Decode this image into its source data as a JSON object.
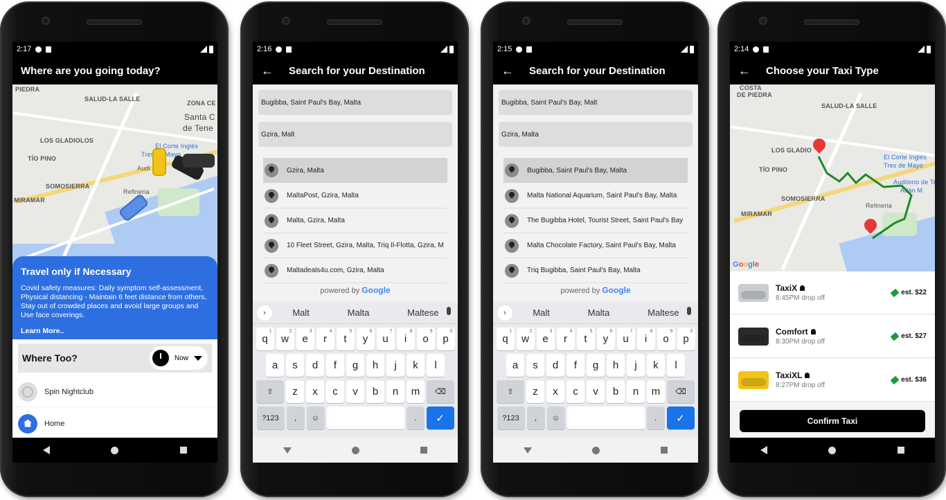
{
  "screen1": {
    "status_time": "2:17",
    "title": "Where are you going today?",
    "map_labels": [
      "PIEDRA",
      "SALUD-LA SALLE",
      "ZONA CE",
      "Santa C",
      "de Tene",
      "LOS GLADIOLOS",
      "TÍO PINO",
      "El Corte Inglés",
      "Tres de Mayo",
      "Audi",
      "SOMOSIERRA",
      "Refineria",
      "MIRAMAR"
    ],
    "google": "Google",
    "covid_title": "Travel only if Necessary",
    "covid_text": "Covid safety measures: Daily symptom self-assessment, Physical distancing - Maintain 6 feet distance from others, Stay out of crowded places and avoid large groups and Use face coverings.",
    "learn_more": "Learn More..",
    "where_label": "Where Too?",
    "when_value": "Now",
    "places": [
      {
        "label": "Spin Nightclub",
        "icon": "clock-icon"
      },
      {
        "label": "Home",
        "icon": "home-icon"
      }
    ]
  },
  "screen2": {
    "status_time": "2:16",
    "title": "Search for your Destination",
    "origin": "Bugibba, Saint Paul's Bay, Malta",
    "destination": "Gzira, Malt",
    "suggestions": [
      "Gzira, Malta",
      "MaltaPost, Gzira, Malta",
      "Malta, Gzira, Malta",
      "10 Fleet Street, Gzira, Malta, Triq Il-Flotta, Gzira, M",
      "Maltadeals4u.com, Gzira, Malta"
    ],
    "powered_by": "powered by",
    "google": "Google",
    "kb_suggestions": [
      "Malt",
      "Malta",
      "Maltese"
    ]
  },
  "screen3": {
    "status_time": "2:15",
    "title": "Search for your Destination",
    "origin": "Bugibba, Saint Paul's Bay, Malt",
    "destination": "Gzira, Malta",
    "suggestions": [
      "Bugibba, Saint Paul's Bay, Malta",
      "Malta National Aquarium, Saint Paul's Bay, Malta",
      "The Bugibba Hotel, Tourist Street, Saint Paul's Bay",
      "Malta Chocolate Factory, Saint Paul's Bay, Malta",
      "Triq Bugibba, Saint Paul's Bay, Malta"
    ],
    "powered_by": "powered by",
    "google": "Google",
    "kb_suggestions": [
      "Malt",
      "Malta",
      "Maltese"
    ]
  },
  "keyboard": {
    "row1": [
      "q",
      "w",
      "e",
      "r",
      "t",
      "y",
      "u",
      "i",
      "o",
      "p"
    ],
    "row1_sup": [
      "1",
      "2",
      "3",
      "4",
      "5",
      "6",
      "7",
      "8",
      "9",
      "0"
    ],
    "row2": [
      "a",
      "s",
      "d",
      "f",
      "g",
      "h",
      "j",
      "k",
      "l"
    ],
    "row3": [
      "z",
      "x",
      "c",
      "v",
      "b",
      "n",
      "m"
    ],
    "symbols": "?123",
    "comma": ",",
    "period": "."
  },
  "screen4": {
    "status_time": "2:14",
    "title": "Choose your Taxi Type",
    "map_labels": [
      "COSTA",
      "DE PIEDRA",
      "SALUD-LA SALLE",
      "LOS GLADIO",
      "El Corte Inglés",
      "Tres de Mayo",
      "TÍO PINO",
      "Auditorio de Te",
      "Adán M",
      "SOMOSIERRA",
      "Refineria",
      "MIRAMAR"
    ],
    "google": "Google",
    "taxis": [
      {
        "name": "TaxiX",
        "dropoff": "8:45PM drop off",
        "price": "est. $22",
        "color": "#c9cdd2"
      },
      {
        "name": "Comfort",
        "dropoff": "8:30PM drop off",
        "price": "est. $27",
        "color": "#2a2a2a"
      },
      {
        "name": "TaxiXL",
        "dropoff": "8:27PM drop off",
        "price": "est. $36",
        "color": "#f2c318"
      }
    ],
    "confirm": "Confirm Taxi"
  },
  "colors": {
    "accent_blue": "#2d6fe0",
    "route_green": "#1e8a1e",
    "pin_red": "#e53935"
  }
}
